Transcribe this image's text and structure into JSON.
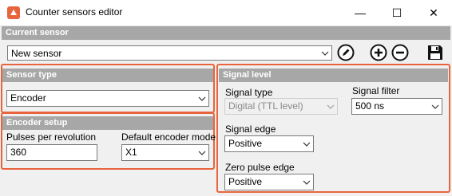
{
  "window": {
    "title": "Counter sensors editor",
    "minimize": "—",
    "maximize": "☐",
    "close": "✕"
  },
  "current_sensor": {
    "header": "Current sensor",
    "value": "New sensor",
    "tools": [
      "edit-icon",
      "add-icon",
      "remove-icon",
      "save-icon"
    ]
  },
  "sensor_type": {
    "header": "Sensor type",
    "value": "Encoder"
  },
  "encoder_setup": {
    "header": "Encoder setup",
    "pulses_label": "Pulses per revolution",
    "pulses_value": "360",
    "mode_label": "Default encoder mode",
    "mode_value": "X1"
  },
  "signal_level": {
    "header": "Signal level",
    "type_label": "Signal type",
    "type_value": "Digital (TTL level)",
    "filter_label": "Signal filter",
    "filter_value": "500 ns",
    "edge_label": "Signal edge",
    "edge_value": "Positive",
    "zero_label": "Zero pulse edge",
    "zero_value": "Positive"
  },
  "colors": {
    "highlight": "#e8643c",
    "header": "#a7a7a7"
  }
}
